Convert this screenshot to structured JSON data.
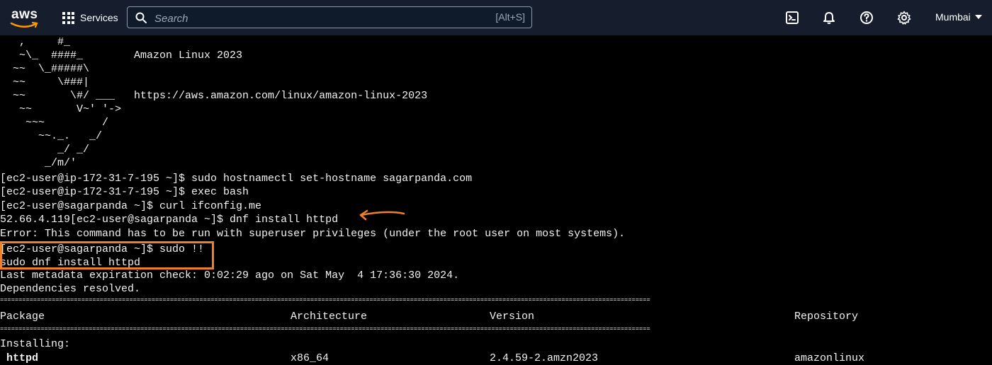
{
  "topbar": {
    "logo_text": "aws",
    "services_label": "Services",
    "search_placeholder": "Search",
    "search_shortcut": "[Alt+S]",
    "region_label": "Mumbai",
    "icons": [
      "cloudshell-icon",
      "bell-icon",
      "help-icon",
      "gear-icon"
    ]
  },
  "terminal": {
    "banner": [
      "   ,     #_",
      "   ~\\_  ####_        Amazon Linux 2023",
      "  ~~  \\_#####\\",
      "  ~~     \\###|",
      "  ~~       \\#/ ___   https://aws.amazon.com/linux/amazon-linux-2023",
      "   ~~       V~' '->",
      "    ~~~         /",
      "      ~~._.   _/",
      "         _/ _/",
      "       _/m/'"
    ],
    "commands": [
      "[ec2-user@ip-172-31-7-195 ~]$ sudo hostnamectl set-hostname sagarpanda.com",
      "[ec2-user@ip-172-31-7-195 ~]$ exec bash",
      "[ec2-user@sagarpanda ~]$ curl ifconfig.me",
      "52.66.4.119[ec2-user@sagarpanda ~]$ dnf install httpd",
      "Error: This command has to be run with superuser privileges (under the root user on most systems).",
      "[ec2-user@sagarpanda ~]$ sudo !!",
      "sudo dnf install httpd",
      "Last metadata expiration check: 0:02:29 ago on Sat May  4 17:36:30 2024.",
      "Dependencies resolved."
    ],
    "separator": "================================================================================================================================================================================",
    "table": {
      "headers": [
        "Package",
        "Architecture",
        "Version",
        "Repository"
      ],
      "section_label": "Installing:",
      "rows": [
        {
          "package": "httpd",
          "arch": "x86_64",
          "version": "2.4.59-2.amzn2023",
          "repo": "amazonlinux"
        }
      ]
    }
  },
  "colors": {
    "topbar_bg": "#161e2d",
    "highlight": "#f07f2a",
    "package_green": "#7ee85b"
  }
}
